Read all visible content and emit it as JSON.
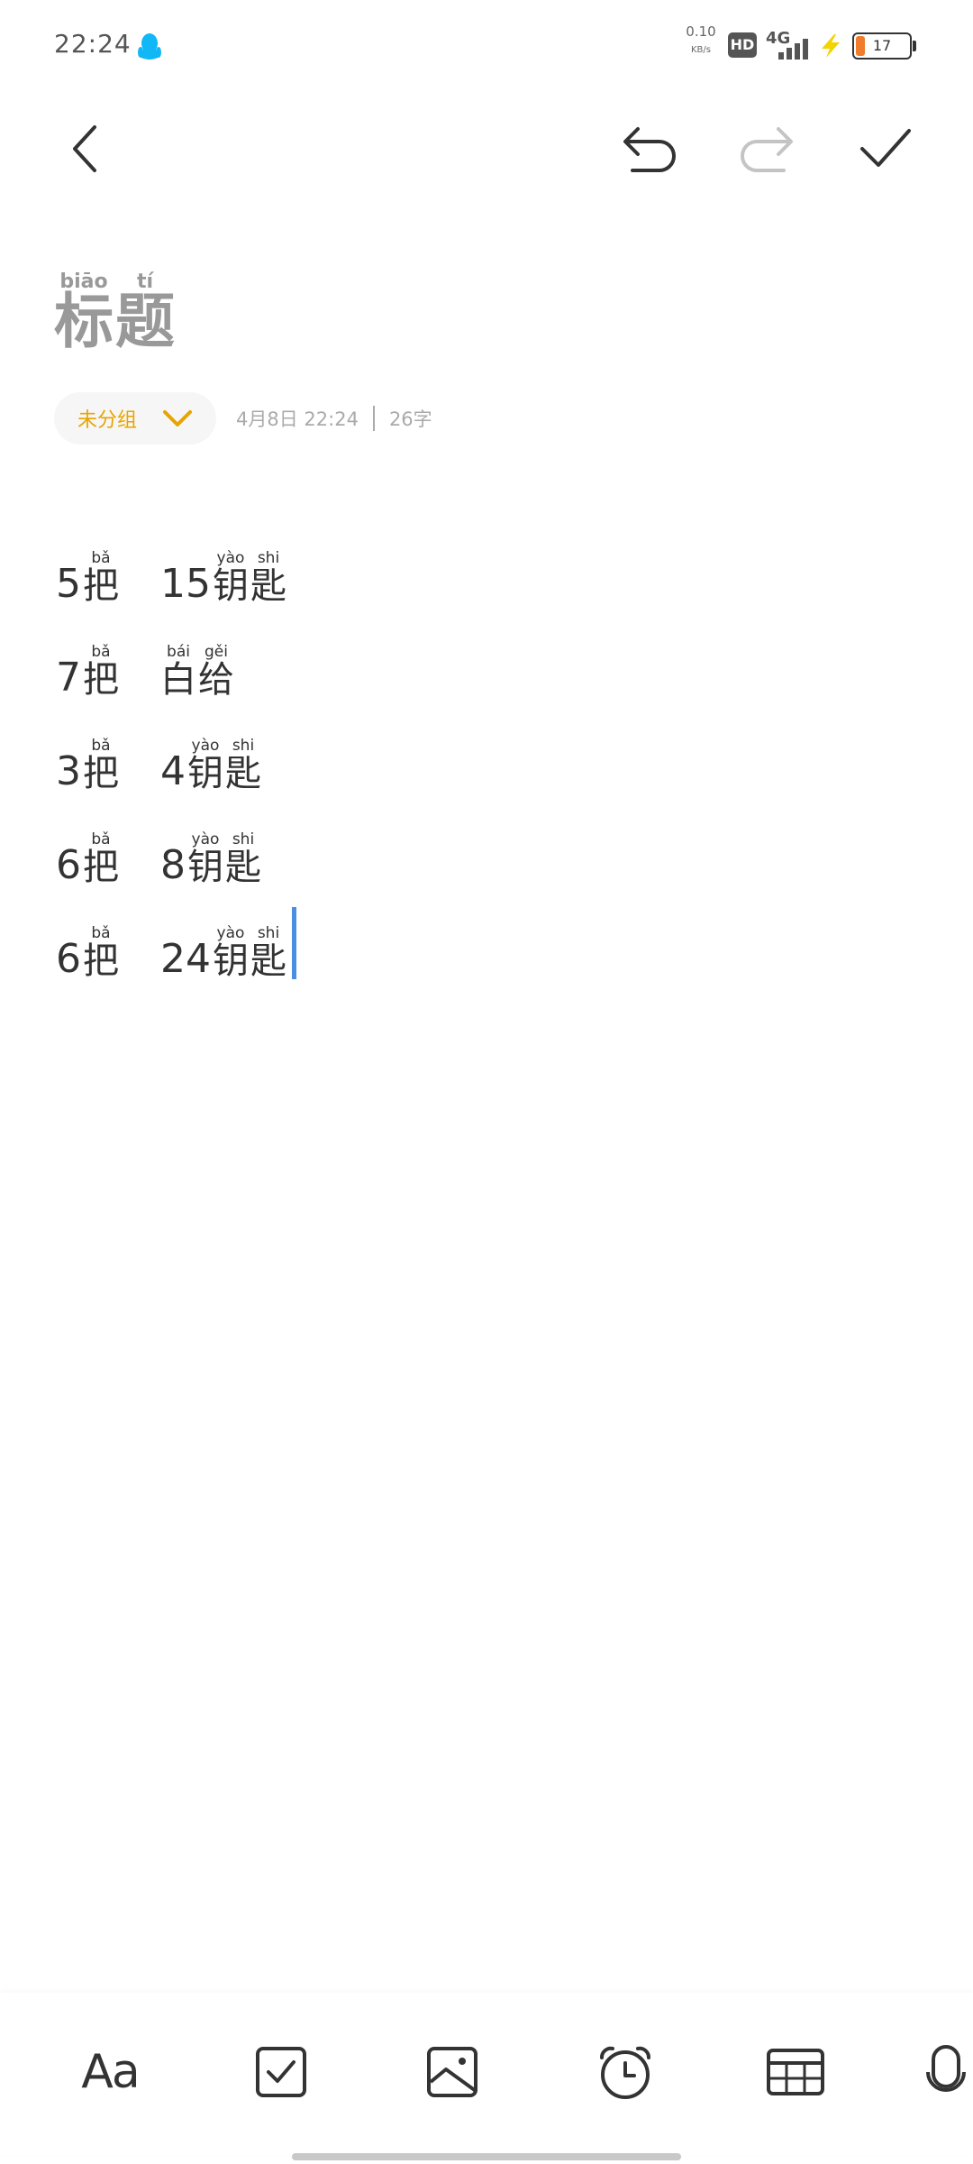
{
  "status_bar": {
    "time": "22:24",
    "net_speed_value": "0.10",
    "net_speed_unit": "KB/s",
    "hd_badge": "HD",
    "network_type": "4G",
    "battery_level": "17",
    "battery_fill_percent": 17,
    "battery_fill_color": "#f07c2c",
    "charge_color": "#f2d400",
    "qq_icon_color": "#12b7f5"
  },
  "top_toolbar": {
    "icons": [
      "back-arrow-icon",
      "undo-icon",
      "redo-icon",
      "confirm-check-icon"
    ],
    "redo_disabled": true
  },
  "note": {
    "title_placeholder": [
      {
        "pinyin": "biāo",
        "char": "标"
      },
      {
        "pinyin": "tí",
        "char": "题"
      }
    ],
    "folder_label": "未分组",
    "date": "4月8日 22:24",
    "char_count": "26字",
    "lines": [
      {
        "parts": [
          {
            "text": "5"
          },
          {
            "pinyin": "bǎ",
            "char": "把"
          },
          {
            "gap": true
          },
          {
            "text": "15"
          },
          {
            "pinyin": "yào",
            "char": "钥"
          },
          {
            "pinyin": "shi",
            "char": "匙"
          }
        ]
      },
      {
        "parts": [
          {
            "text": "7"
          },
          {
            "pinyin": "bǎ",
            "char": "把"
          },
          {
            "gap": true
          },
          {
            "pinyin": "bái",
            "char": "白"
          },
          {
            "pinyin": "gěi",
            "char": "给"
          }
        ]
      },
      {
        "parts": [
          {
            "text": "3"
          },
          {
            "pinyin": "bǎ",
            "char": "把"
          },
          {
            "gap": true
          },
          {
            "text": "4"
          },
          {
            "pinyin": "yào",
            "char": "钥"
          },
          {
            "pinyin": "shi",
            "char": "匙"
          }
        ]
      },
      {
        "parts": [
          {
            "text": "6"
          },
          {
            "pinyin": "bǎ",
            "char": "把"
          },
          {
            "gap": true
          },
          {
            "text": "8"
          },
          {
            "pinyin": "yào",
            "char": "钥"
          },
          {
            "pinyin": "shi",
            "char": "匙"
          }
        ]
      },
      {
        "parts": [
          {
            "text": "6"
          },
          {
            "pinyin": "bǎ",
            "char": "把"
          },
          {
            "gap": true
          },
          {
            "text": "24"
          },
          {
            "pinyin": "yào",
            "char": "钥"
          },
          {
            "pinyin": "shi",
            "char": "匙"
          }
        ],
        "caret": true
      }
    ]
  },
  "bottom_toolbar": {
    "text_format_label": "Aa",
    "icons": [
      "text-format-icon",
      "checklist-icon",
      "image-icon",
      "alarm-clock-icon",
      "table-icon",
      "microphone-icon"
    ]
  },
  "colors": {
    "accent_folder": "#e8a400",
    "caret": "#4a90e2",
    "title_placeholder": "#999999"
  }
}
